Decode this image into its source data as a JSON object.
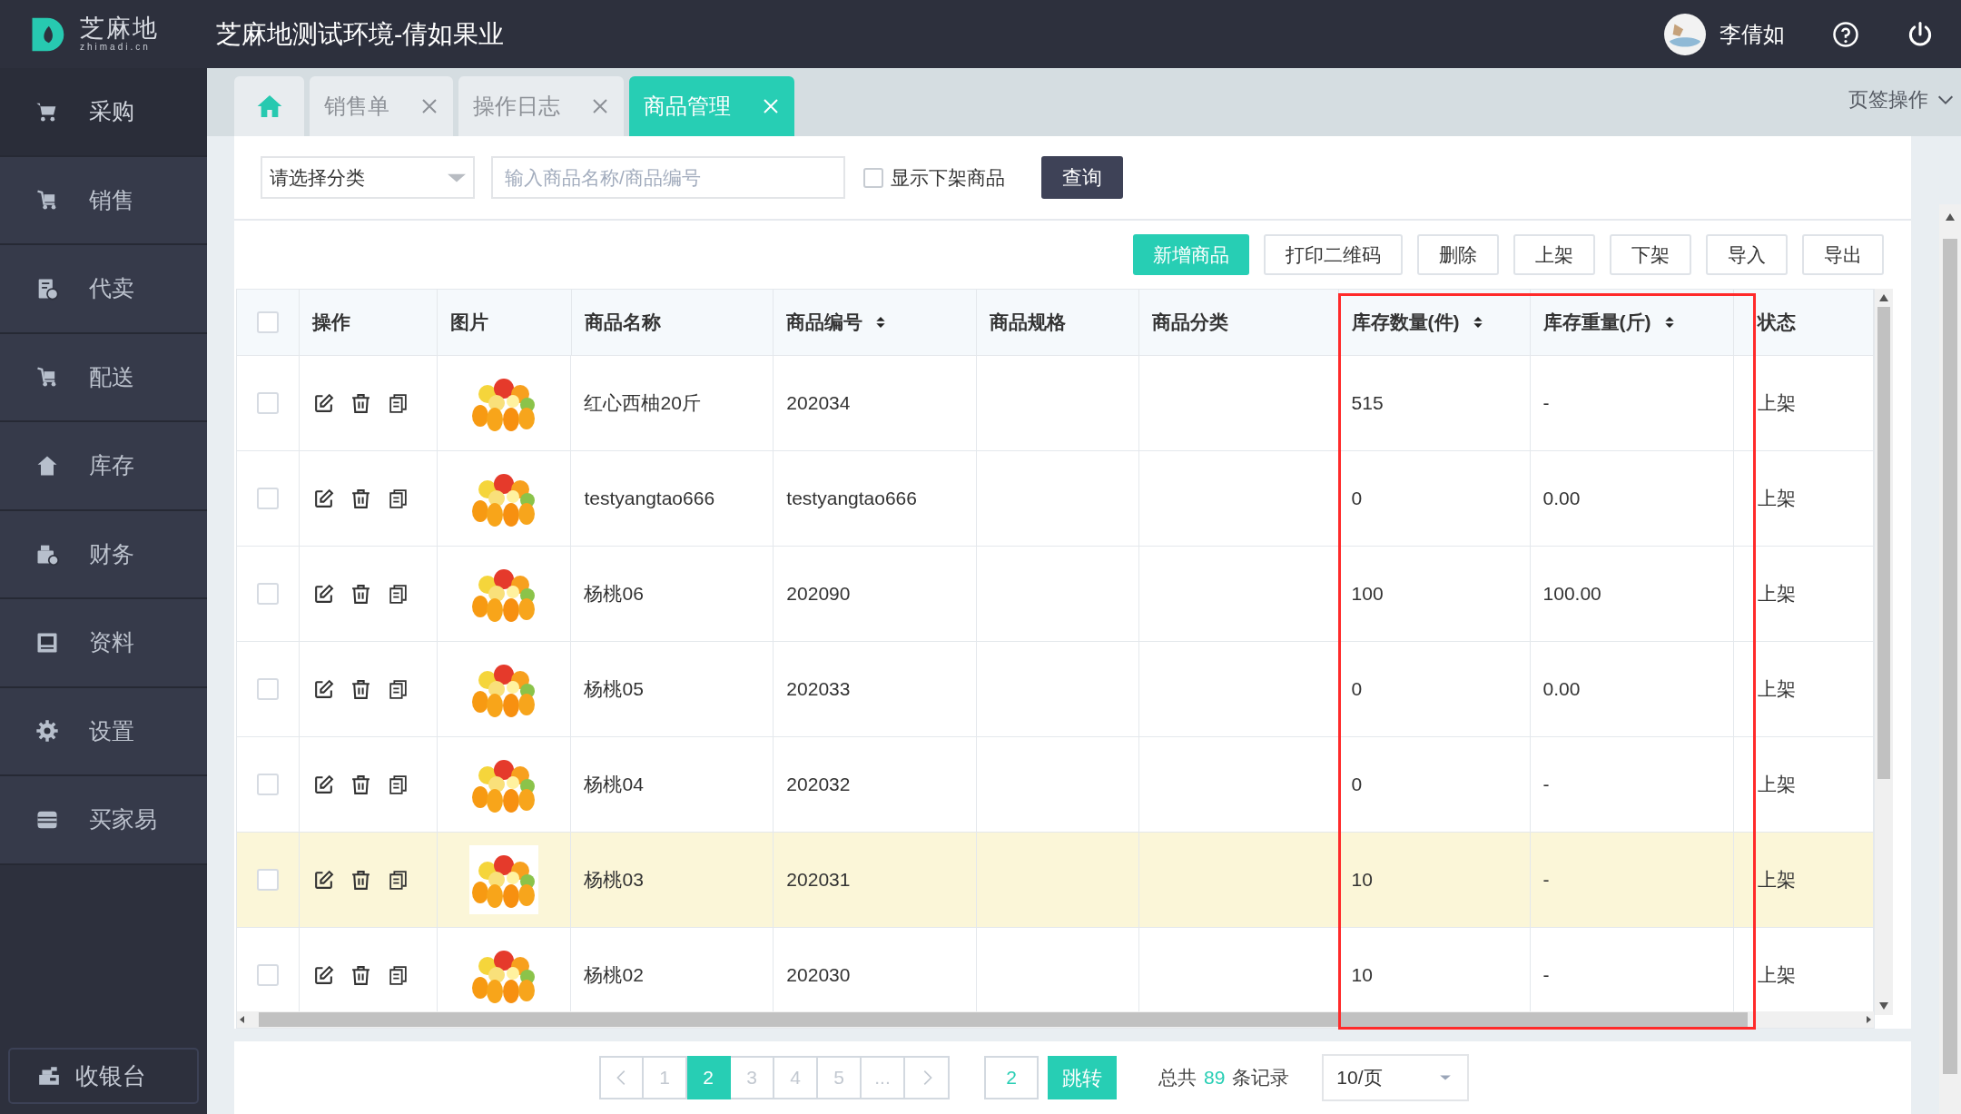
{
  "header": {
    "logo_text": "芝麻地",
    "logo_sub": "zhimadi.cn",
    "title": "芝麻地测试环境-倩如果业",
    "user": "李倩如"
  },
  "sidebar": {
    "items": [
      {
        "label": "采购",
        "selected": true
      },
      {
        "label": "销售",
        "selected": false
      },
      {
        "label": "代卖",
        "selected": false
      },
      {
        "label": "配送",
        "selected": false
      },
      {
        "label": "库存",
        "selected": false
      },
      {
        "label": "财务",
        "selected": false
      },
      {
        "label": "资料",
        "selected": false
      },
      {
        "label": "设置",
        "selected": false
      },
      {
        "label": "买家易",
        "selected": false
      }
    ],
    "cashier": "收银台"
  },
  "tabs": [
    {
      "kind": "home",
      "selected": false
    },
    {
      "kind": "tab",
      "label": "销售单",
      "selected": false
    },
    {
      "kind": "tab",
      "label": "操作日志",
      "selected": false
    },
    {
      "kind": "tab",
      "label": "商品管理",
      "selected": true
    }
  ],
  "tab_actions": "页签操作",
  "filters": {
    "category": "请选择分类",
    "search_placeholder": "输入商品名称/商品编号",
    "show_offshelf": {
      "label": "显示下架商品",
      "checked": false
    },
    "query": "查询"
  },
  "toolbar": [
    {
      "label": "新增商品",
      "primary": true
    },
    {
      "label": "打印二维码",
      "primary": false
    },
    {
      "label": "删除",
      "primary": false
    },
    {
      "label": "上架",
      "primary": false
    },
    {
      "label": "下架",
      "primary": false
    },
    {
      "label": "导入",
      "primary": false
    },
    {
      "label": "导出",
      "primary": false
    }
  ],
  "table": {
    "select_all_checked": false,
    "columns": [
      {
        "label": "操作",
        "sortable": false
      },
      {
        "label": "图片",
        "sortable": false
      },
      {
        "label": "商品名称",
        "sortable": false
      },
      {
        "label": "商品编号",
        "sortable": true
      },
      {
        "label": "商品规格",
        "sortable": false
      },
      {
        "label": "商品分类",
        "sortable": false
      },
      {
        "label": "库存数量(件)",
        "sortable": true
      },
      {
        "label": "库存重量(斤)",
        "sortable": true
      },
      {
        "label": "状态",
        "sortable": false
      }
    ],
    "rows": [
      {
        "checked": false,
        "highlighted": false,
        "name": "红心西柚20斤",
        "code": "202034",
        "qty": "515",
        "weight": "-",
        "status": "上架"
      },
      {
        "checked": false,
        "highlighted": false,
        "name": "testyangtao666",
        "code": "testyangtao666",
        "qty": "0",
        "weight": "0.00",
        "status": "上架"
      },
      {
        "checked": false,
        "highlighted": false,
        "name": "杨桃06",
        "code": "202090",
        "qty": "100",
        "weight": "100.00",
        "status": "上架"
      },
      {
        "checked": false,
        "highlighted": false,
        "name": "杨桃05",
        "code": "202033",
        "qty": "0",
        "weight": "0.00",
        "status": "上架"
      },
      {
        "checked": false,
        "highlighted": false,
        "name": "杨桃04",
        "code": "202032",
        "qty": "0",
        "weight": "-",
        "status": "上架"
      },
      {
        "checked": false,
        "highlighted": true,
        "name": "杨桃03",
        "code": "202031",
        "qty": "10",
        "weight": "-",
        "status": "上架"
      },
      {
        "checked": false,
        "highlighted": false,
        "name": "杨桃02",
        "code": "202030",
        "qty": "10",
        "weight": "-",
        "status": "上架"
      }
    ]
  },
  "pagination": {
    "pages": [
      {
        "label": "1",
        "selected": false
      },
      {
        "label": "2",
        "selected": true
      },
      {
        "label": "3",
        "selected": false
      },
      {
        "label": "4",
        "selected": false
      },
      {
        "label": "5",
        "selected": false
      },
      {
        "label": "...",
        "selected": false
      }
    ],
    "jump_value": "2",
    "jump": "跳转",
    "total_prefix": "总共",
    "total_count": "89",
    "total_suffix": "条记录",
    "page_size": "10/页"
  }
}
